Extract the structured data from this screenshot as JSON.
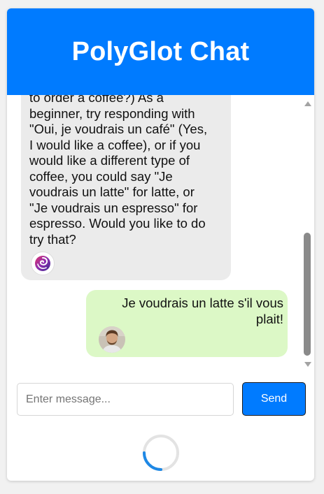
{
  "header": {
    "title": "PolyGlot Chat"
  },
  "messages": [
    {
      "role": "bot",
      "text": "to order a coffee?) As a\nbeginner, try responding with\n\"Oui, je voudrais un café\" (Yes,\nI would like a coffee), or if you\nwould like a different type of\ncoffee, you could say \"Je\nvoudrais un latte\" for latte, or\n\"Je voudrais un espresso\" for\nespresso. Would you like to do\ntry that?",
      "avatar_icon": "swirl-logo-icon"
    },
    {
      "role": "user",
      "text": "Je voudrais un latte s'il vous plait!",
      "avatar_icon": "user-photo-avatar"
    }
  ],
  "composer": {
    "placeholder": "Enter message...",
    "send_label": "Send"
  },
  "colors": {
    "brand": "#007bff",
    "bot_bubble": "#ebebeb",
    "user_bubble": "#dcf8c6"
  },
  "loading": {
    "icon": "loading-spinner-icon"
  }
}
